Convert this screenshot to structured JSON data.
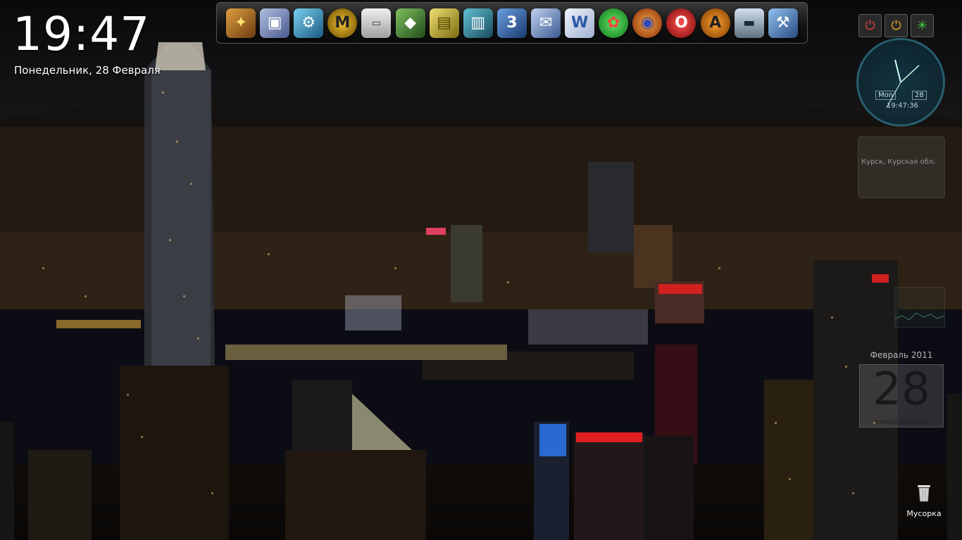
{
  "desktop": {
    "time": "19:47",
    "date": "Понедельник, 28 Февраля"
  },
  "dock": {
    "items": [
      {
        "name": "app-icon",
        "color": "#b3762a"
      },
      {
        "name": "image-viewer-icon",
        "color": "#7a8fb8"
      },
      {
        "name": "network-tool-icon",
        "color": "#4aa4c8"
      },
      {
        "name": "motorola-icon",
        "color": "#e8b020"
      },
      {
        "name": "psp-icon",
        "color": "#dcdcdc"
      },
      {
        "name": "media-app-icon",
        "color": "#4c8a3a"
      },
      {
        "name": "folder-icon",
        "color": "#c8b040"
      },
      {
        "name": "archive-icon",
        "color": "#3a8aa0"
      },
      {
        "name": "3d-app-icon",
        "color": "#3a70a8"
      },
      {
        "name": "mail-icon",
        "color": "#7a9ac8"
      },
      {
        "name": "word-icon",
        "color": "#2a5aa8"
      },
      {
        "name": "icq-icon",
        "color": "#2ab040"
      },
      {
        "name": "firefox-icon",
        "color": "#d05a20"
      },
      {
        "name": "opera-icon",
        "color": "#c81c1c"
      },
      {
        "name": "aimp-icon",
        "color": "#e07a10"
      },
      {
        "name": "laptop-icon",
        "color": "#8a9aaa"
      },
      {
        "name": "tools-icon",
        "color": "#5a8ac8"
      }
    ]
  },
  "sysButtons": {
    "power_color": "#d03030",
    "standby_color": "#e0a020",
    "settings_color": "#40c040"
  },
  "analogClock": {
    "day": "Mon",
    "dayNum": "28",
    "digital": "19:47:36"
  },
  "weather": {
    "city": "Курск, Курская обл."
  },
  "calendar": {
    "month": "Февраль 2011",
    "day": "28",
    "weekday": "понедельник"
  },
  "trash": {
    "label": "Мусорка"
  }
}
